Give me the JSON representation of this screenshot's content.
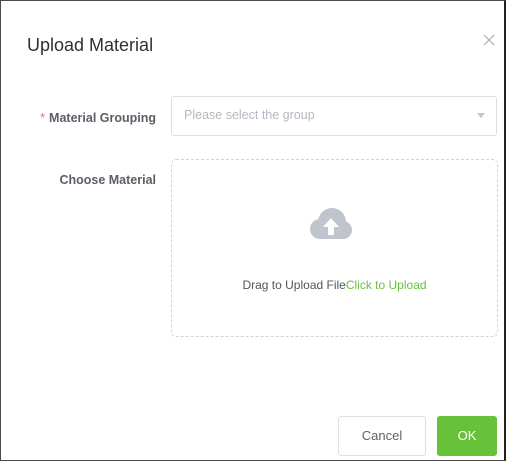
{
  "dialog": {
    "title": "Upload Material",
    "close_icon": "close-icon"
  },
  "form": {
    "grouping": {
      "required_mark": "*",
      "label": "Material Grouping",
      "placeholder": "Please select the group",
      "arrow_icon": "chevron-down-icon"
    },
    "material": {
      "label": "Choose Material",
      "upload_icon": "cloud-upload-icon",
      "drag_text": "Drag to Upload File",
      "click_text": "Click to Upload"
    }
  },
  "footer": {
    "cancel_label": "Cancel",
    "ok_label": "OK"
  },
  "colors": {
    "accent": "#67c23a",
    "required": "#f56c6c",
    "icon": "#c0c4cc"
  }
}
